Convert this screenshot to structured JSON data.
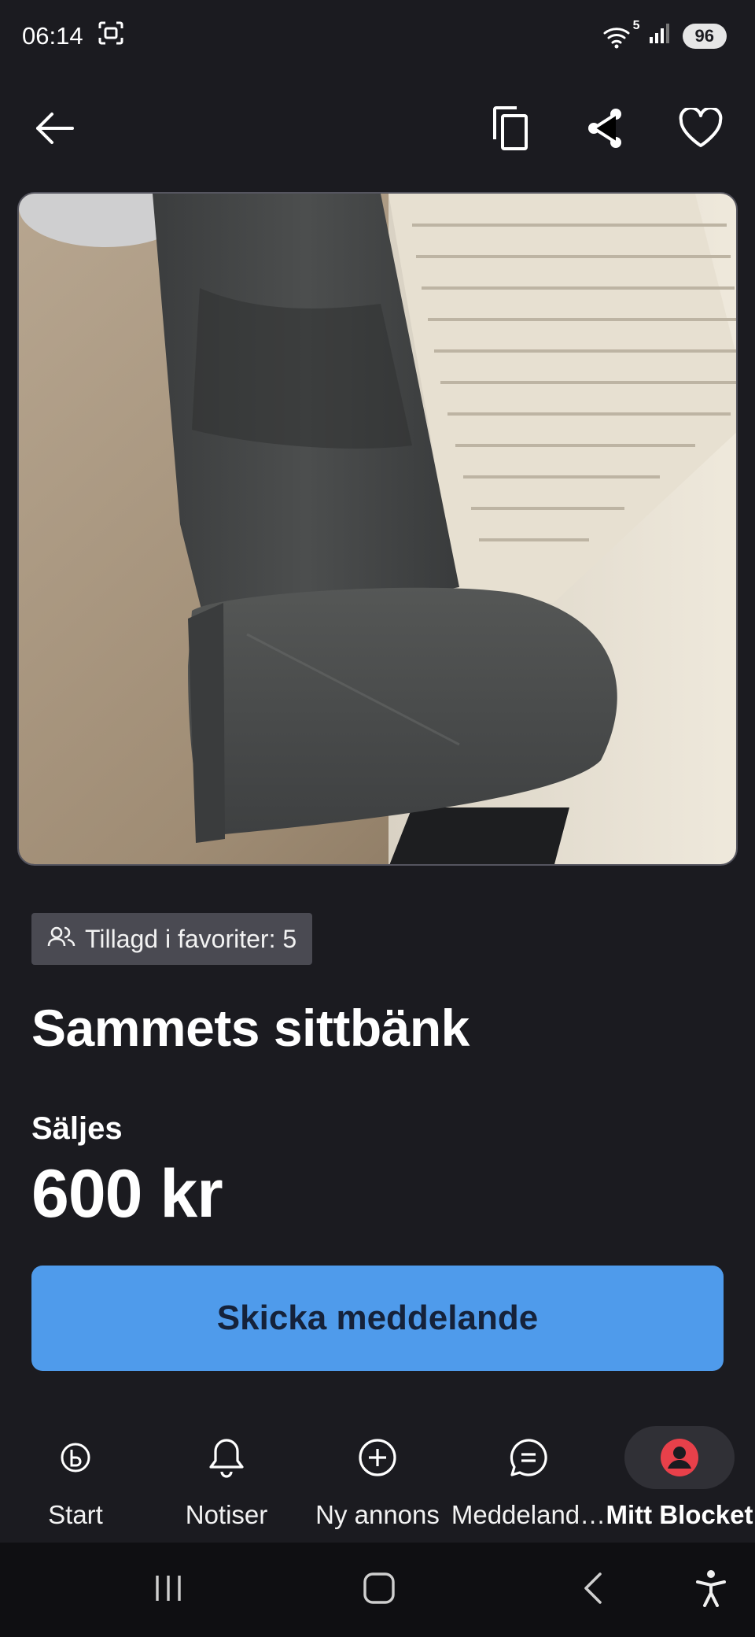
{
  "status_bar": {
    "time": "06:14",
    "wifi_badge": "5",
    "battery": "96"
  },
  "listing": {
    "favorites_label": "Tillagd i favoriter: 5",
    "title": "Sammets sittbänk",
    "sale_type": "Säljes",
    "price": "600 kr",
    "cta_label": "Skicka meddelande"
  },
  "bottom_nav": {
    "items": [
      {
        "label": "Start",
        "icon": "blocket-logo-icon"
      },
      {
        "label": "Notiser",
        "icon": "bell-icon"
      },
      {
        "label": "Ny annons",
        "icon": "plus-circle-icon"
      },
      {
        "label": "Meddeland…",
        "icon": "chat-icon"
      },
      {
        "label": "Mitt Blocket",
        "icon": "profile-icon",
        "active": true
      }
    ]
  },
  "colors": {
    "background": "#1b1b20",
    "cta": "#4f9beb",
    "profile_accent": "#e8404a"
  }
}
